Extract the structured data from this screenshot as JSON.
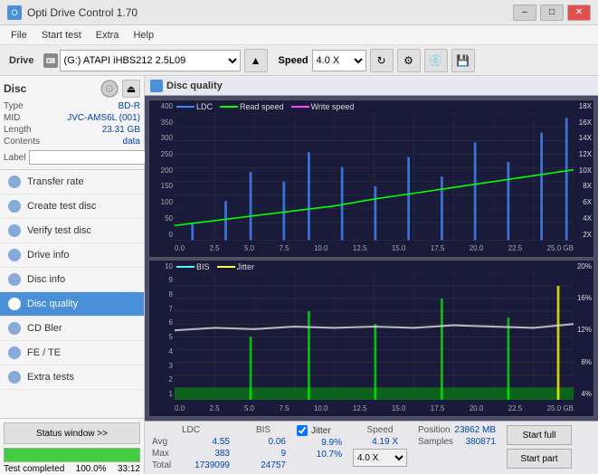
{
  "titlebar": {
    "title": "Opti Drive Control 1.70",
    "icon": "O",
    "minimize": "–",
    "maximize": "□",
    "close": "✕"
  },
  "menubar": {
    "items": [
      "File",
      "Start test",
      "Extra",
      "Help"
    ]
  },
  "toolbar": {
    "drive_label": "Drive",
    "drive_value": "(G:) ATAPI iHBS212 2.5L09",
    "speed_label": "Speed",
    "speed_value": "4.0 X"
  },
  "disc": {
    "title": "Disc",
    "type_label": "Type",
    "type_value": "BD-R",
    "mid_label": "MID",
    "mid_value": "JVC-AMS6L (001)",
    "length_label": "Length",
    "length_value": "23.31 GB",
    "contents_label": "Contents",
    "contents_value": "data",
    "label_label": "Label",
    "label_placeholder": ""
  },
  "nav": {
    "items": [
      {
        "id": "transfer-rate",
        "label": "Transfer rate",
        "active": false
      },
      {
        "id": "create-test-disc",
        "label": "Create test disc",
        "active": false
      },
      {
        "id": "verify-test-disc",
        "label": "Verify test disc",
        "active": false
      },
      {
        "id": "drive-info",
        "label": "Drive info",
        "active": false
      },
      {
        "id": "disc-info",
        "label": "Disc info",
        "active": false
      },
      {
        "id": "disc-quality",
        "label": "Disc quality",
        "active": true
      },
      {
        "id": "cd-bler",
        "label": "CD Bler",
        "active": false
      },
      {
        "id": "fe-te",
        "label": "FE / TE",
        "active": false
      },
      {
        "id": "extra-tests",
        "label": "Extra tests",
        "active": false
      }
    ]
  },
  "status": {
    "button_label": "Status window >>",
    "progress_percent": 100,
    "progress_text": "100.0%",
    "time": "33:12",
    "complete_text": "Test completed"
  },
  "content": {
    "title": "Disc quality",
    "icon_label": "dq"
  },
  "chart1": {
    "title": "LDC",
    "legend": [
      {
        "label": "LDC",
        "color": "#4488ff"
      },
      {
        "label": "Read speed",
        "color": "#00ff00"
      },
      {
        "label": "Write speed",
        "color": "#ff44ff"
      }
    ],
    "y_labels_left": [
      "400",
      "350",
      "300",
      "250",
      "200",
      "150",
      "100",
      "50",
      "0"
    ],
    "y_labels_right": [
      "18X",
      "16X",
      "14X",
      "12X",
      "10X",
      "8X",
      "6X",
      "4X",
      "2X"
    ],
    "x_labels": [
      "0.0",
      "2.5",
      "5.0",
      "7.5",
      "10.0",
      "12.5",
      "15.0",
      "17.5",
      "20.0",
      "22.5",
      "25.0 GB"
    ]
  },
  "chart2": {
    "title": "BIS",
    "legend": [
      {
        "label": "BIS",
        "color": "#44ffff"
      },
      {
        "label": "Jitter",
        "color": "#ffff44"
      }
    ],
    "y_labels_left": [
      "10",
      "9",
      "8",
      "7",
      "6",
      "5",
      "4",
      "3",
      "2",
      "1"
    ],
    "y_labels_right": [
      "20%",
      "16%",
      "12%",
      "8%",
      "4%"
    ],
    "x_labels": [
      "0.0",
      "2.5",
      "5.0",
      "7.5",
      "10.0",
      "12.5",
      "15.0",
      "17.5",
      "20.0",
      "22.5",
      "25.0 GB"
    ]
  },
  "stats": {
    "ldc_header": "LDC",
    "bis_header": "BIS",
    "jitter_header": "Jitter",
    "speed_header": "Speed",
    "avg_label": "Avg",
    "max_label": "Max",
    "total_label": "Total",
    "ldc_avg": "4.55",
    "ldc_max": "383",
    "ldc_total": "1739099",
    "bis_avg": "0.06",
    "bis_max": "9",
    "bis_total": "24757",
    "jitter_avg": "9.9%",
    "jitter_max": "10.7%",
    "jitter_total": "",
    "speed_value": "4.19 X",
    "speed_select": "4.0 X",
    "position_label": "Position",
    "position_value": "23862 MB",
    "samples_label": "Samples",
    "samples_value": "380871",
    "btn_start_full": "Start full",
    "btn_start_part": "Start part"
  }
}
